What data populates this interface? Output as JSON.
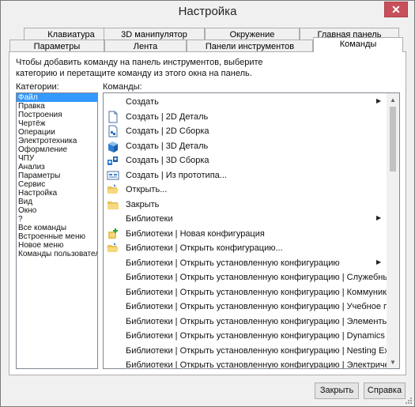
{
  "window": {
    "title": "Настройка",
    "close_label": "✕"
  },
  "tabs": {
    "row1": [
      "Клавиатура",
      "3D манипулятор",
      "Окружение",
      "Главная панель"
    ],
    "row2": [
      "Параметры",
      "Лента",
      "Панели инструментов",
      "Команды"
    ],
    "active": "Команды"
  },
  "instructions": "Чтобы добавить команду на панель инструментов, выберите категорию и перетащите команду из этого окна на панель.",
  "categories_label": "Категории:",
  "commands_label": "Команды:",
  "categories": [
    "Файл",
    "Правка",
    "Построения",
    "Чертёж",
    "Операции",
    "Электротехника",
    "Оформление",
    "ЧПУ",
    "Анализ",
    "Параметры",
    "Сервис",
    "Настройка",
    "Вид",
    "Окно",
    "?",
    "Все команды",
    "Встроенные меню",
    "Новое меню",
    "Команды пользователя"
  ],
  "selected_category": "Файл",
  "commands": [
    {
      "label": "Создать",
      "icon": "none",
      "submenu": true
    },
    {
      "label": "Создать | 2D Деталь",
      "icon": "document-icon",
      "submenu": false
    },
    {
      "label": "Создать | 2D Сборка",
      "icon": "assembly-2d-icon",
      "submenu": false
    },
    {
      "label": "Создать | 3D Деталь",
      "icon": "cube-icon",
      "submenu": false
    },
    {
      "label": "Создать | 3D Сборка",
      "icon": "assembly-3d-icon",
      "submenu": false
    },
    {
      "label": "Создать | Из прототипа...",
      "icon": "prototype-icon",
      "submenu": false
    },
    {
      "label": "Открыть...",
      "icon": "open-folder-icon",
      "submenu": false
    },
    {
      "label": "Закрыть",
      "icon": "close-folder-icon",
      "submenu": false
    },
    {
      "label": "Библиотеки",
      "icon": "none",
      "submenu": true
    },
    {
      "label": "Библиотеки | Новая конфигурация",
      "icon": "new-config-icon",
      "submenu": false
    },
    {
      "label": "Библиотеки | Открыть конфигурацию...",
      "icon": "open-folder-icon",
      "submenu": false
    },
    {
      "label": "Библиотеки | Открыть установленную конфигурацию",
      "icon": "none",
      "submenu": true
    },
    {
      "label": "Библиотеки | Открыть установленную конфигурацию | Служебные",
      "icon": "none",
      "submenu": false
    },
    {
      "label": "Библиотеки | Открыть установленную конфигурацию | Коммуникац...",
      "icon": "none",
      "submenu": false
    },
    {
      "label": "Библиотеки | Открыть установленную конфигурацию | Учебное пос...",
      "icon": "none",
      "submenu": false
    },
    {
      "label": "Библиотеки | Открыть установленную конфигурацию | Элементы эл...",
      "icon": "none",
      "submenu": false
    },
    {
      "label": "Библиотеки | Открыть установленную конфигурацию | Dynamics Exa...",
      "icon": "none",
      "submenu": false
    },
    {
      "label": "Библиотеки | Открыть установленную конфигурацию | Nesting Exam...",
      "icon": "none",
      "submenu": false
    },
    {
      "label": "Библиотеки | Открыть установленную конфигурацию | Электрическ...",
      "icon": "none",
      "submenu": false
    }
  ],
  "buttons": {
    "close": "Закрыть",
    "help": "Справка"
  },
  "colors": {
    "selection": "#3399ff",
    "close_button": "#c7505a"
  }
}
